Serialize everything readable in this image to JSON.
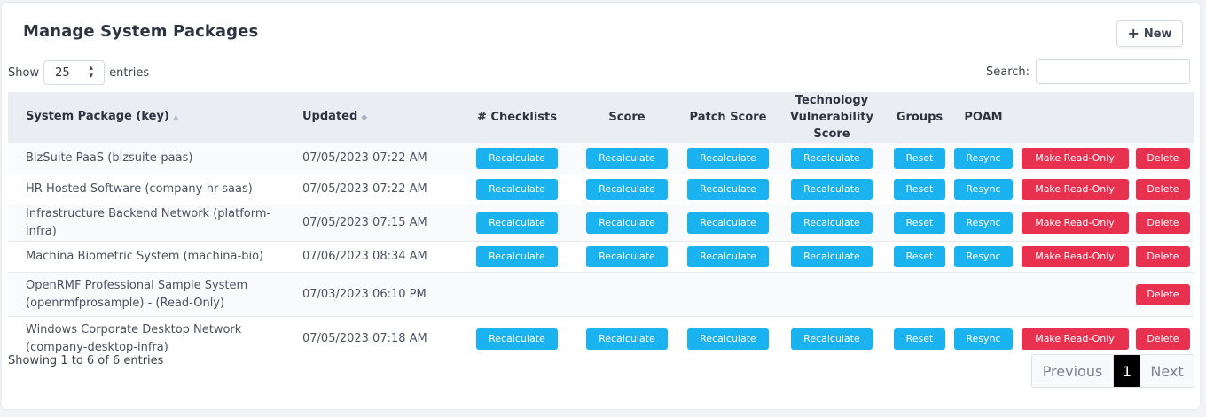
{
  "header": {
    "title": "Manage System Packages",
    "new_button": "New"
  },
  "length": {
    "show_label": "Show",
    "value": "25",
    "entries_label": "entries"
  },
  "search": {
    "label": "Search:",
    "value": ""
  },
  "columns": {
    "package": "System Package (key)",
    "updated": "Updated",
    "checklists": "# Checklists",
    "score": "Score",
    "patch_score": "Patch Score",
    "tech_vuln_line1": "Technology",
    "tech_vuln_line2": "Vulnerability Score",
    "groups": "Groups",
    "poam": "POAM"
  },
  "buttons": {
    "recalculate": "Recalculate",
    "reset": "Reset",
    "resync": "Resync",
    "make_read_only": "Make Read-Only",
    "delete": "Delete"
  },
  "rows": [
    {
      "name_line1": "BizSuite PaaS (bizsuite-paas)",
      "name_line2": "",
      "updated": "07/05/2023 07:22 AM"
    },
    {
      "name_line1": "HR Hosted Software (company-hr-saas)",
      "name_line2": "",
      "updated": "07/05/2023 07:22 AM"
    },
    {
      "name_line1": "Infrastructure Backend Network (platform-infra)",
      "name_line2": "",
      "updated": "07/05/2023 07:15 AM"
    },
    {
      "name_line1": "Machina Biometric System (machina-bio)",
      "name_line2": "",
      "updated": "07/06/2023 08:34 AM"
    },
    {
      "name_line1": "OpenRMF Professional Sample System",
      "name_line2": "(openrmfprosample) - (Read-Only)",
      "updated": "07/03/2023 06:10 PM"
    },
    {
      "name_line1": "Windows Corporate Desktop Network",
      "name_line2": "(company-desktop-infra)",
      "updated": "07/05/2023 07:18 AM"
    }
  ],
  "footer": {
    "info": "Showing 1 to 6 of 6 entries"
  },
  "pagination": {
    "previous": "Previous",
    "current": "1",
    "next": "Next"
  },
  "colors": {
    "blue_button": "#1ab3f0",
    "red_button": "#e8304f",
    "header_row": "#eaeef3"
  }
}
